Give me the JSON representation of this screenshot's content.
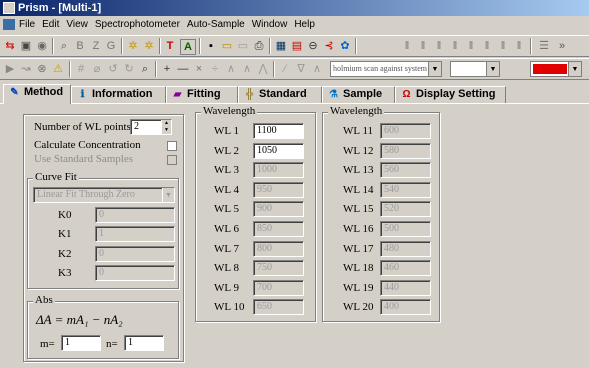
{
  "window": {
    "title": "Prism - [Multi-1]"
  },
  "menu": [
    "File",
    "Edit",
    "View",
    "Spectrophotometer",
    "Auto-Sample",
    "Window",
    "Help"
  ],
  "toolbar": {
    "scan_combo": "holmium scan against system",
    "color_accent": "#e00000"
  },
  "tabs": [
    {
      "label": "Method",
      "icon": "pen-icon"
    },
    {
      "label": "Information",
      "icon": "information-icon"
    },
    {
      "label": "Fitting",
      "icon": "fitting-chart-icon"
    },
    {
      "label": "Standard",
      "icon": "standard-icon"
    },
    {
      "label": "Sample",
      "icon": "sample-icon"
    },
    {
      "label": "Display Setting",
      "icon": "display-omega-icon"
    }
  ],
  "method": {
    "num_wl_label": "Number of WL points",
    "num_wl_value": "2",
    "calc_conc_label": "Calculate Concentration",
    "use_std_label": "Use Standard Samples",
    "curve_fit": {
      "title": "Curve Fit",
      "selected": "Linear Fit Through Zero",
      "k0_label": "K0",
      "k0_value": "0",
      "k1_label": "K1",
      "k1_value": "1",
      "k2_label": "K2",
      "k2_value": "0",
      "k3_label": "K3",
      "k3_value": "0"
    },
    "abs": {
      "title": "Abs",
      "formula": "ΔA = mA₁ − nA₂",
      "m_label": "m=",
      "m_value": "1",
      "n_label": "n=",
      "n_value": "1"
    }
  },
  "wavelength": {
    "title1": "Wavelength",
    "title2": "Wavelength",
    "left": [
      {
        "label": "WL 1",
        "value": "1100"
      },
      {
        "label": "WL 2",
        "value": "1050"
      },
      {
        "label": "WL 3",
        "value": "1000"
      },
      {
        "label": "WL 4",
        "value": "950"
      },
      {
        "label": "WL 5",
        "value": "900"
      },
      {
        "label": "WL 6",
        "value": "850"
      },
      {
        "label": "WL 7",
        "value": "800"
      },
      {
        "label": "WL 8",
        "value": "750"
      },
      {
        "label": "WL 9",
        "value": "700"
      },
      {
        "label": "WL 10",
        "value": "650"
      }
    ],
    "right": [
      {
        "label": "WL 11",
        "value": "600"
      },
      {
        "label": "WL 12",
        "value": "580"
      },
      {
        "label": "WL 13",
        "value": "560"
      },
      {
        "label": "WL 14",
        "value": "540"
      },
      {
        "label": "WL 15",
        "value": "520"
      },
      {
        "label": "WL 16",
        "value": "500"
      },
      {
        "label": "WL 17",
        "value": "480"
      },
      {
        "label": "WL 18",
        "value": "460"
      },
      {
        "label": "WL 19",
        "value": "440"
      },
      {
        "label": "WL 20",
        "value": "400"
      }
    ]
  }
}
